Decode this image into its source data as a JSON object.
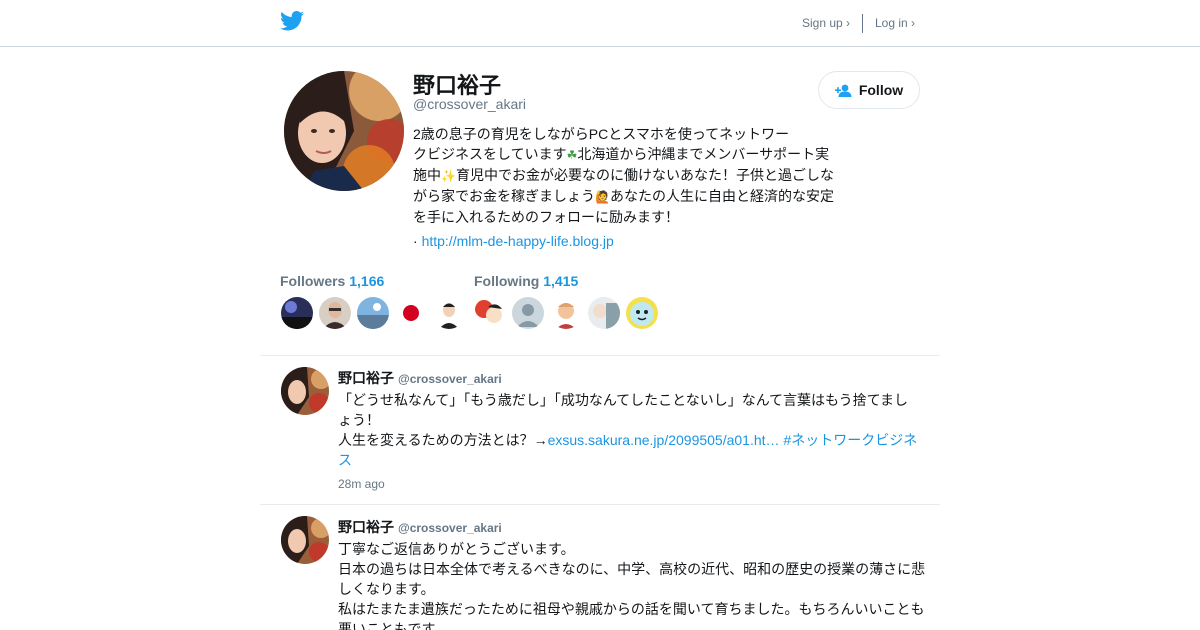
{
  "colors": {
    "accent": "#1b95e0",
    "muted": "#657786",
    "text": "#14171a",
    "border": "#e6ecf0"
  },
  "topbar": {
    "logo_icon": "twitter-bird-icon",
    "signup_label": "Sign up ›",
    "login_label": "Log in ›"
  },
  "profile": {
    "name": "野口裕子",
    "handle": "@crossover_akari",
    "follow_label": "Follow",
    "follow_icon": "add-user-icon",
    "bio_lines": [
      "2歳の息子の育児をしながらPCとスマホを使ってネットワー",
      "クビジネスをしています",
      "北海道から沖縄までメンバーサポート実",
      "施中",
      "育児中でお金が必要なのに働けないあなた！子供と過ごしな",
      "がら家でお金を稼ぎましょう",
      "あなたの人生に自由と経済的な安定",
      "を手に入れるためのフォローに励みます！"
    ],
    "bio_emoji": [
      "☘",
      "✨",
      "🙋"
    ],
    "url_prefix": "·",
    "url": "http://mlm-de-happy-life.blog.jp"
  },
  "stats": {
    "followers_label": "Followers",
    "followers_count": "1,166",
    "following_label": "Following",
    "following_count": "1,415"
  },
  "tweets": [
    {
      "name": "野口裕子",
      "handle": "@crossover_akari",
      "line1": "「どうせ私なんて」「もう歳だし」「成功なんてしたことないし」なんて言葉はもう捨てまし",
      "line2": "ょう！",
      "line3_text": "人生を変えるための方法とは？→",
      "link": "exsus.sakura.ne.jp/2099505/a01.ht…",
      "hashtag_a": "#ネットワークビジネ",
      "hashtag_b": "ス",
      "time": "28m ago"
    },
    {
      "name": "野口裕子",
      "handle": "@crossover_akari",
      "line1": "丁寧なご返信ありがとうございます。",
      "line2": "日本の過ちは日本全体で考えるべきなのに、中学、高校の近代、昭和の歴史の授業の薄さに悲",
      "line3": "しくなります。",
      "line4": "私はたまたま遺族だったために祖母や親戚からの話を聞いて育ちました。もちろんいいことも",
      "line5": "悪いこともです。"
    }
  ]
}
